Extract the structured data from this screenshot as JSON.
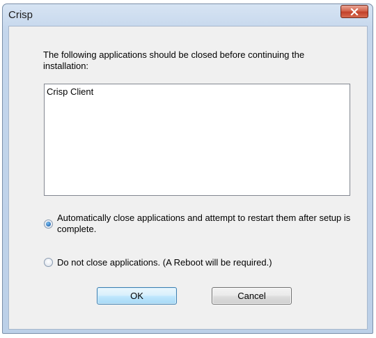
{
  "window": {
    "title": "Crisp"
  },
  "dialog": {
    "message": "The following applications should be closed before continuing the installation:",
    "applications": [
      "Crisp Client"
    ],
    "options": [
      {
        "label": "Automatically close applications and attempt to restart them after setup is complete.",
        "checked": true
      },
      {
        "label": "Do not close applications. (A Reboot will be required.)",
        "checked": false
      }
    ],
    "ok_label": "OK",
    "cancel_label": "Cancel"
  },
  "icons": {
    "close": "close-icon"
  },
  "colors": {
    "close_button": "#c2412a",
    "default_button_border": "#3c7fb1",
    "client_background": "#f0f0f0"
  }
}
